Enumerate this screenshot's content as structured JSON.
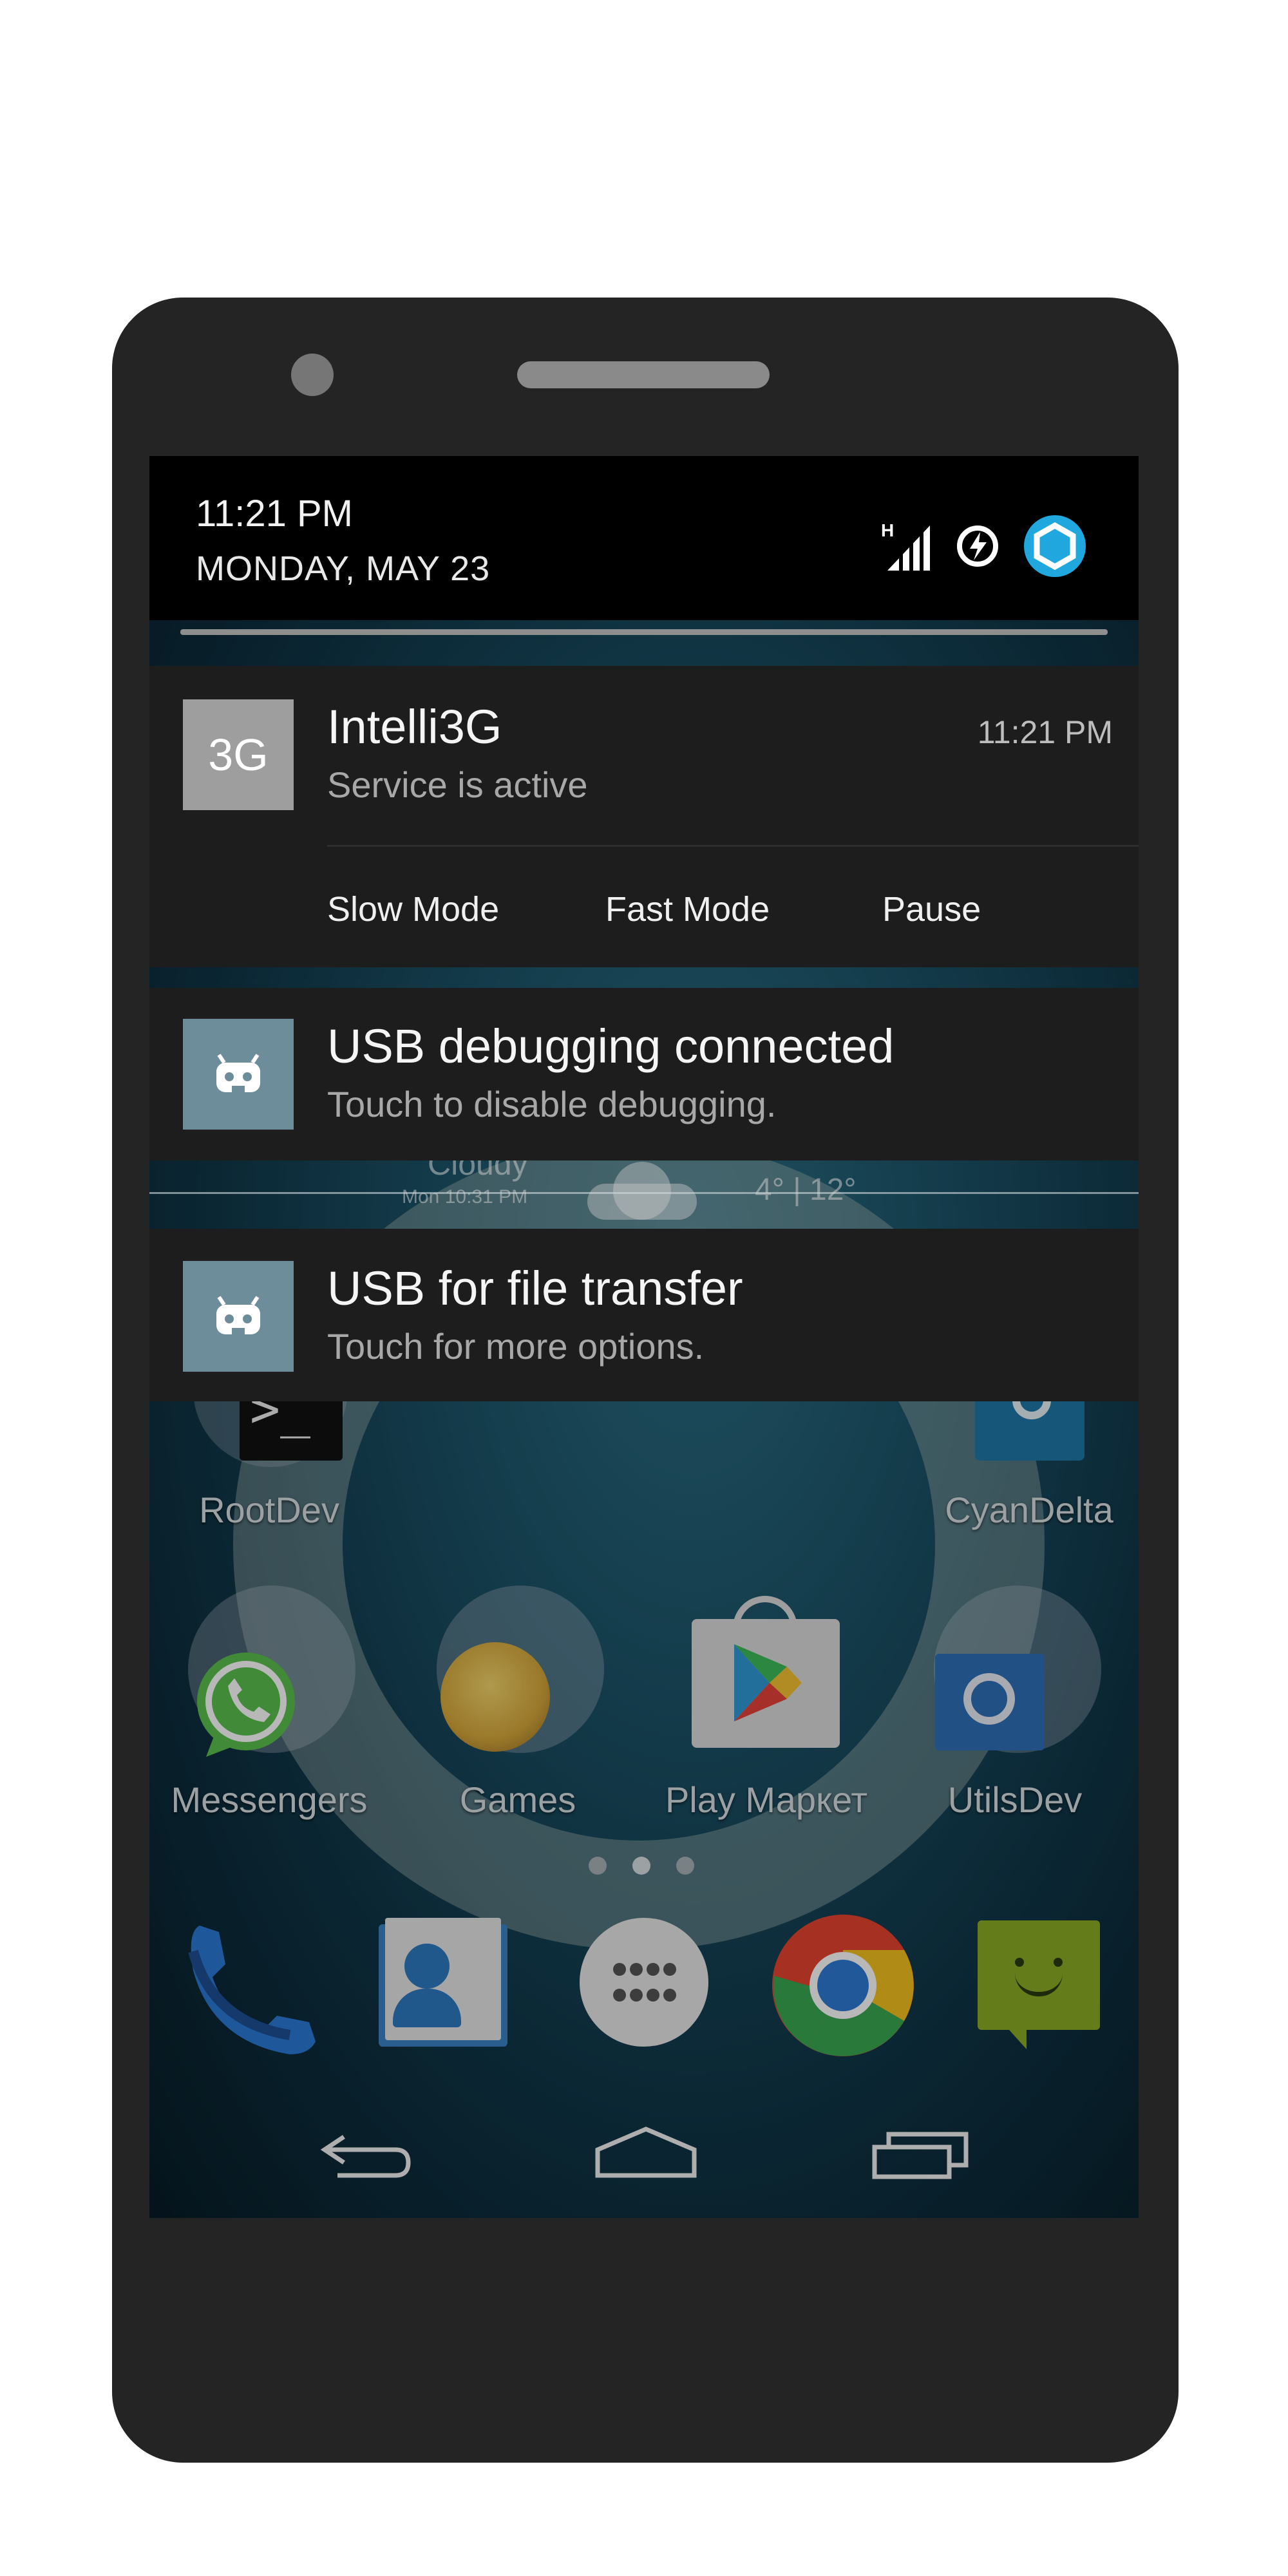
{
  "status": {
    "time": "11:21 PM",
    "date": "MONDAY, MAY 23",
    "network_type": "H"
  },
  "notifications": [
    {
      "app": "Intelli3G",
      "icon_label": "3G",
      "title": "Intelli3G",
      "text": "Service is active",
      "time": "11:21 PM",
      "actions": [
        "Slow Mode",
        "Fast Mode",
        "Pause"
      ]
    },
    {
      "title": "USB debugging connected",
      "text": "Touch to disable debugging.",
      "icon": "android-robot-icon"
    },
    {
      "title": "USB for file transfer",
      "text": "Touch for more options.",
      "icon": "android-robot-icon"
    }
  ],
  "weather_peek": {
    "condition": "Cloudy",
    "updated": "Mon 10:31 PM",
    "temps": "4° | 12°"
  },
  "home": {
    "row1": [
      {
        "label": "RootDev"
      },
      {
        "label": "CyanDelta"
      }
    ],
    "row2": [
      {
        "label": "Messengers"
      },
      {
        "label": "Games"
      },
      {
        "label": "Play Маркет"
      },
      {
        "label": "UtilsDev"
      }
    ],
    "page_count": 3,
    "dock": [
      "phone-icon",
      "contacts-icon",
      "app-drawer-icon",
      "chrome-icon",
      "messaging-icon"
    ]
  },
  "colors": {
    "notification_bg": "#1d1d1d",
    "header_bg": "#000000",
    "icon_tile_gray": "#9e9e9e",
    "icon_tile_blue": "#6e8d9b",
    "cm_accent": "#1fa7de"
  }
}
